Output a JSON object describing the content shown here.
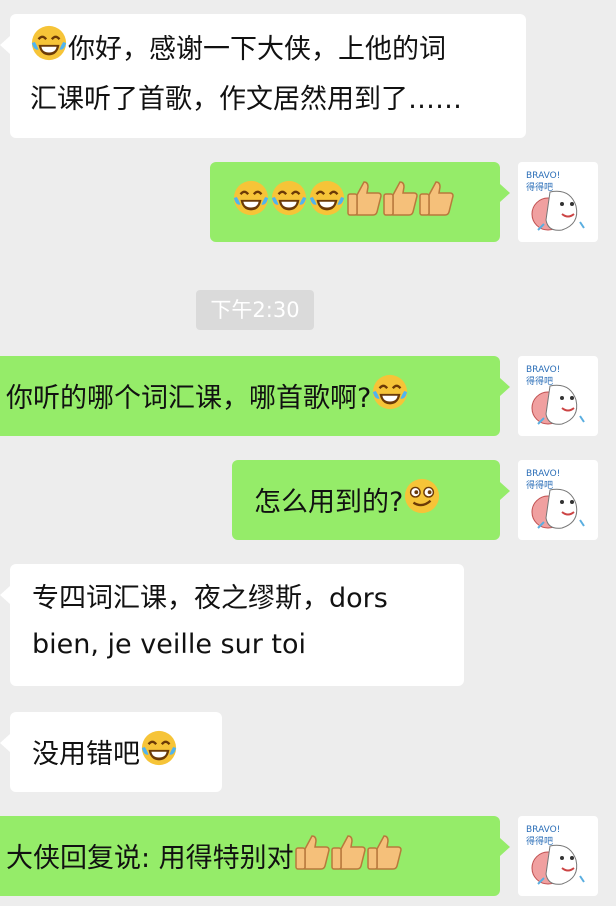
{
  "messages": [
    {
      "id": "m1",
      "side": "in",
      "lines": [
        "你好，感谢一下大侠，上他的词",
        "汇课听了首歌，作文居然用到了……"
      ],
      "emoji_prefix": [
        "laugh-tears"
      ],
      "emoji_suffix": []
    },
    {
      "id": "m2",
      "side": "out",
      "text": "",
      "emoji_prefix": [],
      "emoji_suffix": [
        "laugh-tears",
        "laugh-tears",
        "laugh-tears",
        "thumbs-up",
        "thumbs-up",
        "thumbs-up"
      ]
    },
    {
      "id": "m3",
      "side": "out",
      "text": "你听的哪个词汇课，哪首歌啊?",
      "emoji_suffix": [
        "laugh-tears"
      ]
    },
    {
      "id": "m4",
      "side": "out",
      "text": "怎么用到的?",
      "emoji_suffix": [
        "wink-face"
      ]
    },
    {
      "id": "m5",
      "side": "in",
      "lines": [
        "专四词汇课，夜之缪斯，dors",
        "bien, je veille sur toi"
      ]
    },
    {
      "id": "m6",
      "side": "in",
      "text": "没用错吧",
      "emoji_suffix": [
        "laugh-tears"
      ]
    },
    {
      "id": "m7",
      "side": "out",
      "text": "大侠回复说: 用得特别对",
      "emoji_suffix": [
        "thumbs-up",
        "thumbs-up",
        "thumbs-up"
      ]
    }
  ],
  "timestamp": "下午2:30",
  "sticker_text": [
    "BRAVO!",
    "得得吧"
  ],
  "colors": {
    "background": "#ededed",
    "incoming": "#ffffff",
    "outgoing": "#95ec69"
  }
}
